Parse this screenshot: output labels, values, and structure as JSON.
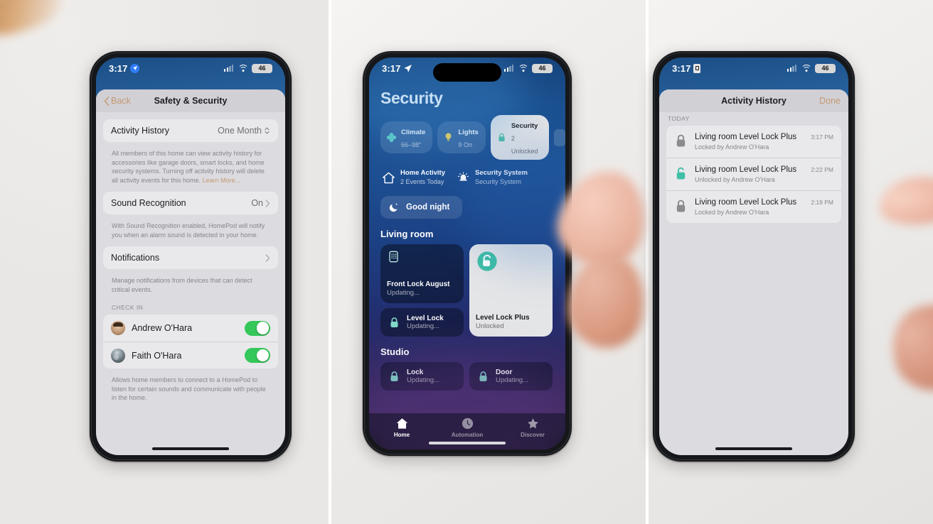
{
  "background": {
    "color": "#f0eeec",
    "divider_color": "#ffffff"
  },
  "accents": {
    "tan": "#c49a72",
    "green_toggle": "#34c759",
    "lock_teal": "#4fbfa8",
    "blue_badge": "#2f7cf6"
  },
  "phone1": {
    "status": {
      "time": "3:17",
      "badge_icon": "location-arrow-icon",
      "signal_icon": "cellular-signal-icon",
      "wifi_icon": "wifi-icon",
      "battery": "46"
    },
    "nav": {
      "back_label": "Back",
      "back_icon": "chevron-left-icon",
      "title": "Safety & Security"
    },
    "rows": {
      "activity_history_label": "Activity History",
      "activity_history_value": "One Month",
      "activity_history_icon": "chevron-up-down-icon",
      "activity_history_note": "All members of this home can view activity history for accessories like garage doors, smart locks, and home security systems. Turning off activity history will delete all activity events for this home. ",
      "activity_history_link": "Learn More...",
      "sound_recognition_label": "Sound Recognition",
      "sound_recognition_value": "On",
      "sound_recognition_icon": "chevron-right-icon",
      "sound_recognition_note": "With Sound Recognition enabled, HomePod will notify you when an alarm sound is detected in your home.",
      "notifications_label": "Notifications",
      "notifications_icon": "chevron-right-icon",
      "notifications_note": "Manage notifications from devices that can detect critical events.",
      "check_in_header": "CHECK IN",
      "check_in_note": "Allows home members to connect to a HomePod to listen for certain sounds and communicate with people in the home."
    },
    "members": [
      {
        "name": "Andrew O'Hara",
        "avatar": "avatar-andrew",
        "toggle": "on"
      },
      {
        "name": "Faith O'Hara",
        "avatar": "avatar-faith",
        "toggle": "on"
      }
    ]
  },
  "phone2": {
    "status": {
      "time": "3:17",
      "badge_icon": "location-arrow-icon",
      "signal_icon": "cellular-signal-icon",
      "wifi_icon": "wifi-icon",
      "battery": "46"
    },
    "title": "Security",
    "chips": [
      {
        "title": "Climate",
        "subtitle": "66–98°",
        "icon": "fan-icon",
        "active": false
      },
      {
        "title": "Lights",
        "subtitle": "9 On",
        "icon": "lightbulb-icon",
        "active": false
      },
      {
        "title": "Security",
        "subtitle": "2 Unlocked",
        "icon": "lock-icon",
        "active": true
      }
    ],
    "summaries": [
      {
        "title": "Home Activity",
        "subtitle": "2 Events Today",
        "icon": "house-icon"
      },
      {
        "title": "Security System",
        "subtitle": "Security System",
        "icon": "alarm-icon"
      }
    ],
    "scene": {
      "label": "Good night",
      "icon": "moon-stars-icon"
    },
    "rooms": [
      {
        "name": "Living room",
        "large_tiles": [
          {
            "name": "Front Lock August",
            "status": "Updating...",
            "icon": "keypad-lock-icon",
            "on": false
          },
          {
            "name": "Level Lock Plus",
            "status": "Unlocked",
            "icon": "unlock-icon",
            "on": true
          }
        ],
        "small_tiles": [
          {
            "name": "Level Lock",
            "status": "Updating...",
            "icon": "lock-icon"
          }
        ]
      },
      {
        "name": "Studio",
        "small_tiles": [
          {
            "name": "Lock",
            "status": "Updating...",
            "icon": "lock-icon"
          },
          {
            "name": "Door",
            "status": "Updating...",
            "icon": "lock-icon"
          }
        ]
      }
    ],
    "tabs": [
      {
        "label": "Home",
        "icon": "house-icon",
        "active": true
      },
      {
        "label": "Automation",
        "icon": "clock-icon",
        "active": false
      },
      {
        "label": "Discover",
        "icon": "star-icon",
        "active": false
      }
    ]
  },
  "phone3": {
    "status": {
      "time": "3:17",
      "badge_icon": "lock-badge-icon",
      "signal_icon": "cellular-signal-icon",
      "wifi_icon": "wifi-icon",
      "battery": "46"
    },
    "nav": {
      "title": "Activity History",
      "done_label": "Done"
    },
    "section_header": "TODAY",
    "events": [
      {
        "title": "Living room Level Lock Plus",
        "detail": "Locked by Andrew O'Hara",
        "time": "3:17 PM",
        "icon": "lock-icon",
        "state": "locked"
      },
      {
        "title": "Living room Level Lock Plus",
        "detail": "Unlocked by Andrew O'Hara",
        "time": "2:22 PM",
        "icon": "unlock-icon",
        "state": "unlocked"
      },
      {
        "title": "Living room Level Lock Plus",
        "detail": "Locked by Andrew O'Hara",
        "time": "2:19 PM",
        "icon": "lock-icon",
        "state": "locked"
      }
    ]
  }
}
